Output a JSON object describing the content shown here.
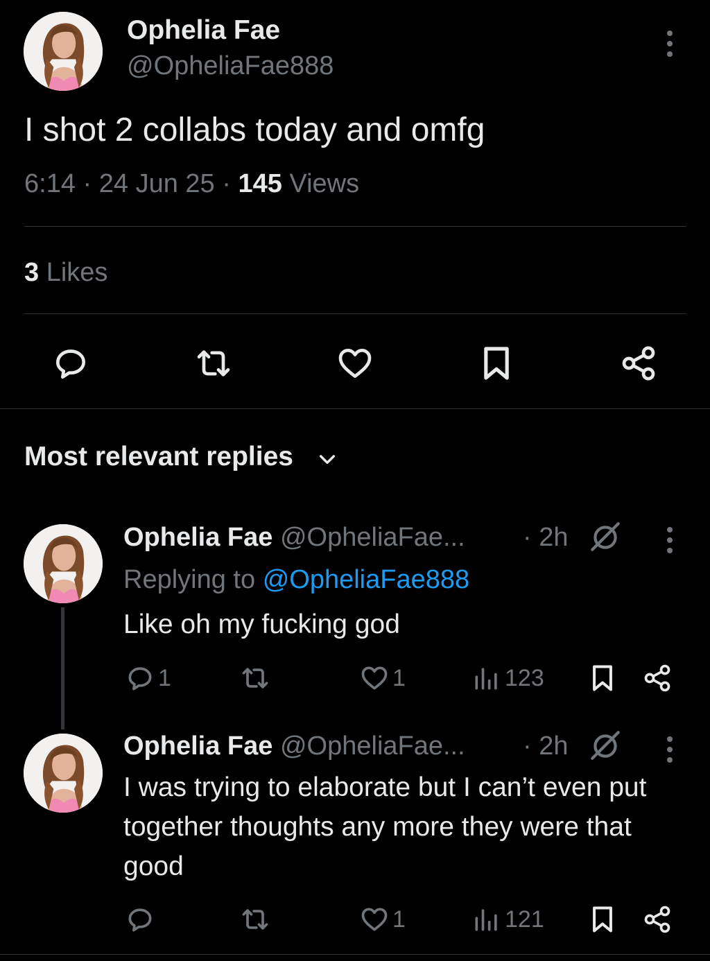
{
  "tweet": {
    "author_name": "Ophelia Fae",
    "author_handle": "@OpheliaFae888",
    "text": "I shot 2 collabs today and omfg",
    "time": "6:14",
    "date": "24 Jun 25",
    "views_count": "145",
    "views_label": "Views",
    "likes_count": "3",
    "likes_label": "Likes",
    "actions": [
      "reply-icon",
      "retweet-icon",
      "like-icon",
      "bookmark-icon",
      "share-icon"
    ]
  },
  "replies_header": {
    "label": "Most relevant replies"
  },
  "replies": [
    {
      "author_name": "Ophelia Fae",
      "author_handle": "@OpheliaFae...",
      "time": "· 2h",
      "replying_to_label": "Replying to",
      "replying_to_handle": "@OpheliaFae888",
      "text": "Like oh my fucking god",
      "reply_count": "1",
      "retweet_count": "",
      "like_count": "1",
      "views": "123"
    },
    {
      "author_name": "Ophelia Fae",
      "author_handle": "@OpheliaFae...",
      "time": "· 2h",
      "text": "I was trying to elaborate but I can’t even put together thoughts any more they were that good",
      "reply_count": "",
      "retweet_count": "",
      "like_count": "1",
      "views": "121"
    }
  ],
  "colors": {
    "background": "#000000",
    "text_primary": "#e7e9ea",
    "text_secondary": "#71767b",
    "link": "#1d9bf0",
    "divider": "#2f3336"
  }
}
